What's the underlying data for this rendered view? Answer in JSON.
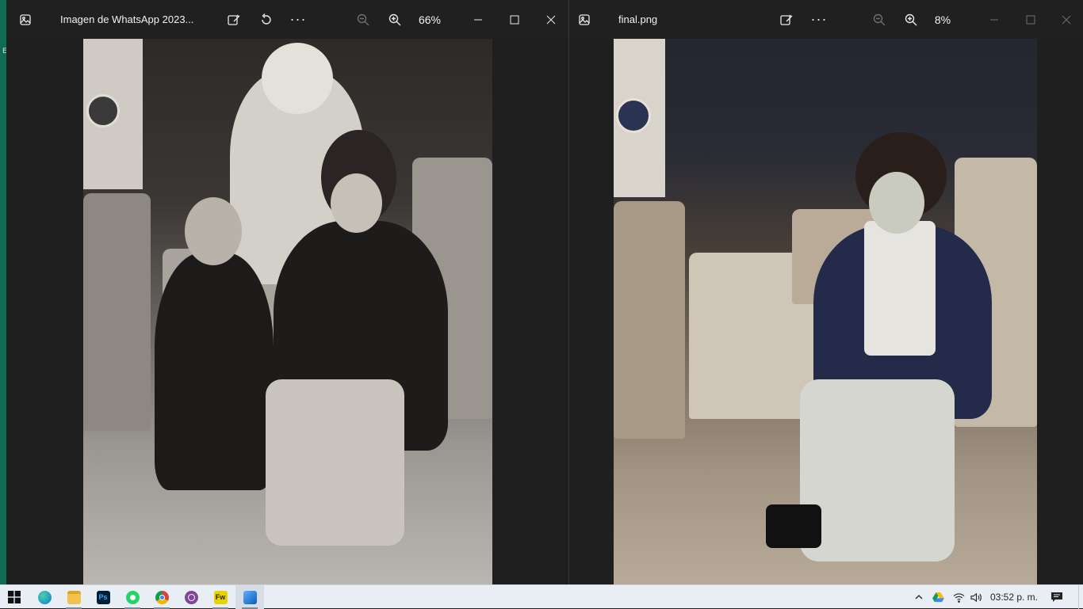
{
  "left_window": {
    "title": "Imagen de WhatsApp 2023...",
    "zoom": "66%",
    "icons": [
      "photos-app-icon",
      "edit-image-icon",
      "rotate-icon",
      "more-options-icon",
      "zoom-out-icon",
      "zoom-in-icon"
    ]
  },
  "right_window": {
    "title": "final.png",
    "zoom": "8%",
    "icons": [
      "photos-app-icon",
      "edit-image-icon",
      "more-options-icon",
      "zoom-out-icon",
      "zoom-in-icon"
    ]
  },
  "window_controls": [
    "minimize-icon",
    "maximize-icon",
    "close-icon"
  ],
  "taskbar": {
    "apps": [
      "windows-start",
      "edge",
      "file-explorer",
      "photoshop",
      "whatsapp",
      "chrome",
      "tor-browser",
      "fireworks",
      "photos"
    ],
    "clock": "03:52 p. m.",
    "tray_icons": [
      "chevron-up-icon",
      "google-drive-icon",
      "wifi-icon",
      "volume-icon",
      "notifications-icon"
    ]
  },
  "colors": {
    "titlebar": "#202020",
    "window_bg": "#1f1f1f",
    "taskbar": "#e9eef4",
    "photoshop": "#001e36",
    "whatsapp": "#25d366",
    "fireworks": "#e6d300"
  }
}
